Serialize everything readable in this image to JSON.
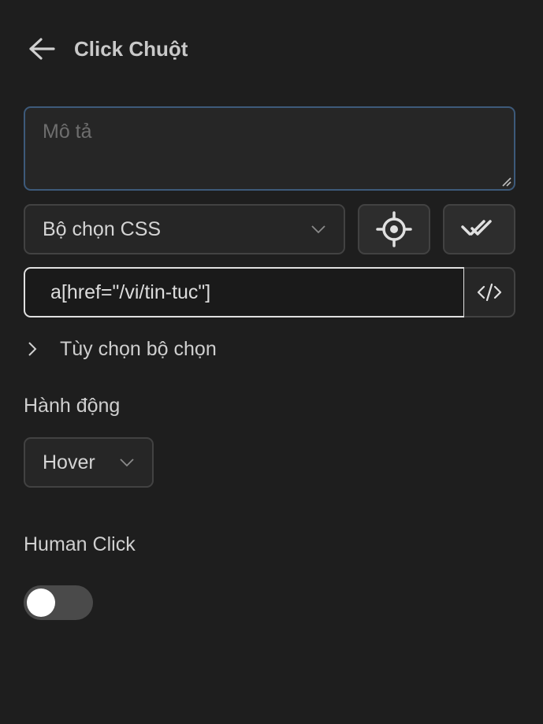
{
  "header": {
    "title": "Click Chuột",
    "back_icon": "arrow-left-icon"
  },
  "description": {
    "placeholder": "Mô tả",
    "value": ""
  },
  "selector_type": {
    "value": "Bộ chọn CSS"
  },
  "buttons": {
    "pick_element_icon": "crosshair-icon",
    "verify_icon": "double-check-icon",
    "code_icon": "code-icon"
  },
  "selector": {
    "value": "a[href=\"/vi/tin-tuc\"]"
  },
  "selector_options": {
    "label": "Tùy chọn bộ chọn"
  },
  "action": {
    "label": "Hành động",
    "value": "Hover"
  },
  "human_click": {
    "label": "Human Click",
    "enabled": false
  },
  "colors": {
    "background": "#1e1e1e",
    "focus_border": "#3d5a7a",
    "active_border": "#e0e0e0"
  }
}
